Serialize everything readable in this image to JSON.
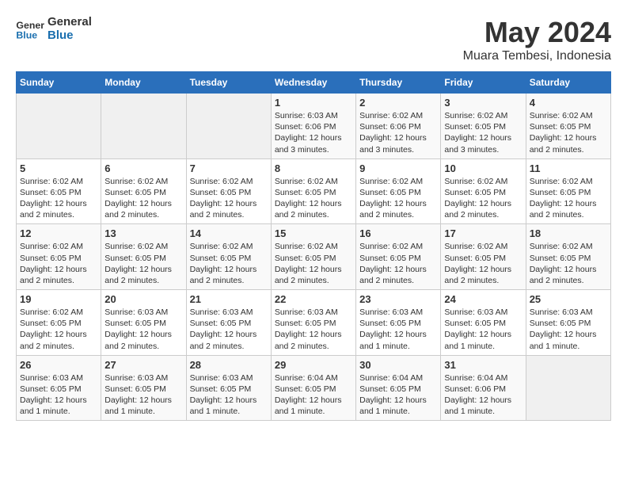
{
  "logo": {
    "line1": "General",
    "line2": "Blue"
  },
  "title": "May 2024",
  "subtitle": "Muara Tembesi, Indonesia",
  "weekdays": [
    "Sunday",
    "Monday",
    "Tuesday",
    "Wednesday",
    "Thursday",
    "Friday",
    "Saturday"
  ],
  "weeks": [
    [
      {
        "day": "",
        "info": ""
      },
      {
        "day": "",
        "info": ""
      },
      {
        "day": "",
        "info": ""
      },
      {
        "day": "1",
        "info": "Sunrise: 6:03 AM\nSunset: 6:06 PM\nDaylight: 12 hours\nand 3 minutes."
      },
      {
        "day": "2",
        "info": "Sunrise: 6:02 AM\nSunset: 6:06 PM\nDaylight: 12 hours\nand 3 minutes."
      },
      {
        "day": "3",
        "info": "Sunrise: 6:02 AM\nSunset: 6:05 PM\nDaylight: 12 hours\nand 3 minutes."
      },
      {
        "day": "4",
        "info": "Sunrise: 6:02 AM\nSunset: 6:05 PM\nDaylight: 12 hours\nand 2 minutes."
      }
    ],
    [
      {
        "day": "5",
        "info": "Sunrise: 6:02 AM\nSunset: 6:05 PM\nDaylight: 12 hours\nand 2 minutes."
      },
      {
        "day": "6",
        "info": "Sunrise: 6:02 AM\nSunset: 6:05 PM\nDaylight: 12 hours\nand 2 minutes."
      },
      {
        "day": "7",
        "info": "Sunrise: 6:02 AM\nSunset: 6:05 PM\nDaylight: 12 hours\nand 2 minutes."
      },
      {
        "day": "8",
        "info": "Sunrise: 6:02 AM\nSunset: 6:05 PM\nDaylight: 12 hours\nand 2 minutes."
      },
      {
        "day": "9",
        "info": "Sunrise: 6:02 AM\nSunset: 6:05 PM\nDaylight: 12 hours\nand 2 minutes."
      },
      {
        "day": "10",
        "info": "Sunrise: 6:02 AM\nSunset: 6:05 PM\nDaylight: 12 hours\nand 2 minutes."
      },
      {
        "day": "11",
        "info": "Sunrise: 6:02 AM\nSunset: 6:05 PM\nDaylight: 12 hours\nand 2 minutes."
      }
    ],
    [
      {
        "day": "12",
        "info": "Sunrise: 6:02 AM\nSunset: 6:05 PM\nDaylight: 12 hours\nand 2 minutes."
      },
      {
        "day": "13",
        "info": "Sunrise: 6:02 AM\nSunset: 6:05 PM\nDaylight: 12 hours\nand 2 minutes."
      },
      {
        "day": "14",
        "info": "Sunrise: 6:02 AM\nSunset: 6:05 PM\nDaylight: 12 hours\nand 2 minutes."
      },
      {
        "day": "15",
        "info": "Sunrise: 6:02 AM\nSunset: 6:05 PM\nDaylight: 12 hours\nand 2 minutes."
      },
      {
        "day": "16",
        "info": "Sunrise: 6:02 AM\nSunset: 6:05 PM\nDaylight: 12 hours\nand 2 minutes."
      },
      {
        "day": "17",
        "info": "Sunrise: 6:02 AM\nSunset: 6:05 PM\nDaylight: 12 hours\nand 2 minutes."
      },
      {
        "day": "18",
        "info": "Sunrise: 6:02 AM\nSunset: 6:05 PM\nDaylight: 12 hours\nand 2 minutes."
      }
    ],
    [
      {
        "day": "19",
        "info": "Sunrise: 6:02 AM\nSunset: 6:05 PM\nDaylight: 12 hours\nand 2 minutes."
      },
      {
        "day": "20",
        "info": "Sunrise: 6:03 AM\nSunset: 6:05 PM\nDaylight: 12 hours\nand 2 minutes."
      },
      {
        "day": "21",
        "info": "Sunrise: 6:03 AM\nSunset: 6:05 PM\nDaylight: 12 hours\nand 2 minutes."
      },
      {
        "day": "22",
        "info": "Sunrise: 6:03 AM\nSunset: 6:05 PM\nDaylight: 12 hours\nand 2 minutes."
      },
      {
        "day": "23",
        "info": "Sunrise: 6:03 AM\nSunset: 6:05 PM\nDaylight: 12 hours\nand 1 minute."
      },
      {
        "day": "24",
        "info": "Sunrise: 6:03 AM\nSunset: 6:05 PM\nDaylight: 12 hours\nand 1 minute."
      },
      {
        "day": "25",
        "info": "Sunrise: 6:03 AM\nSunset: 6:05 PM\nDaylight: 12 hours\nand 1 minute."
      }
    ],
    [
      {
        "day": "26",
        "info": "Sunrise: 6:03 AM\nSunset: 6:05 PM\nDaylight: 12 hours\nand 1 minute."
      },
      {
        "day": "27",
        "info": "Sunrise: 6:03 AM\nSunset: 6:05 PM\nDaylight: 12 hours\nand 1 minute."
      },
      {
        "day": "28",
        "info": "Sunrise: 6:03 AM\nSunset: 6:05 PM\nDaylight: 12 hours\nand 1 minute."
      },
      {
        "day": "29",
        "info": "Sunrise: 6:04 AM\nSunset: 6:05 PM\nDaylight: 12 hours\nand 1 minute."
      },
      {
        "day": "30",
        "info": "Sunrise: 6:04 AM\nSunset: 6:05 PM\nDaylight: 12 hours\nand 1 minute."
      },
      {
        "day": "31",
        "info": "Sunrise: 6:04 AM\nSunset: 6:06 PM\nDaylight: 12 hours\nand 1 minute."
      },
      {
        "day": "",
        "info": ""
      }
    ]
  ]
}
